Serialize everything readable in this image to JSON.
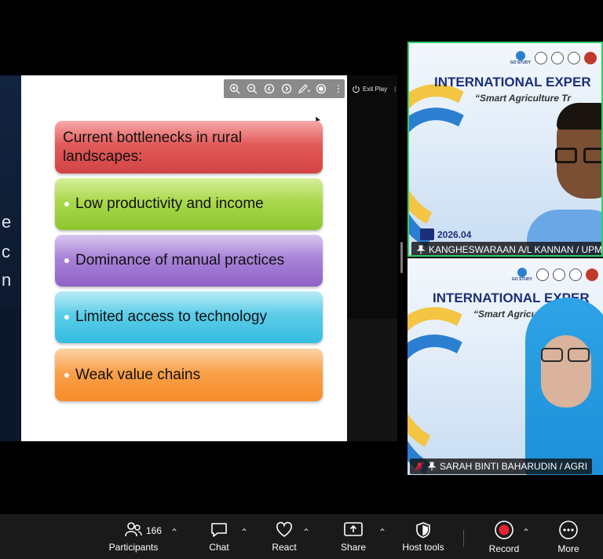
{
  "slide": {
    "heading": "Current bottlenecks in rural landscapes:",
    "bullets": [
      "Low productivity and income",
      "Dominance of manual practices",
      "Limited access to technology",
      "Weak value chains"
    ],
    "left_fragments": [
      "e",
      "c",
      "n"
    ]
  },
  "presentation_toolbar": {
    "exit_label": "Exit Play"
  },
  "participants": [
    {
      "banner_title": "INTERNATIONAL EXPER",
      "banner_sub": "“Smart Agriculture Tr",
      "date_text": "2026.04",
      "name": "KANGHESWARAAN A/L KANNAN / UPM",
      "active_speaker": true
    },
    {
      "banner_title": "INTERNATIONAL EXPER",
      "banner_sub": "“Smart Agricu",
      "name": "SARAH BINTI BAHARUDIN / AGRI",
      "muted": true
    }
  ],
  "banner_logo_text": "GO STUDY",
  "toolbar": {
    "participants_label": "Participants",
    "participants_count": "166",
    "chat_label": "Chat",
    "react_label": "React",
    "share_label": "Share",
    "host_tools_label": "Host tools",
    "record_label": "Record",
    "more_label": "More"
  },
  "colors": {
    "active_speaker_border": "#2fd06b",
    "record_red": "#e8232f",
    "muted_red": "#e8232f"
  }
}
